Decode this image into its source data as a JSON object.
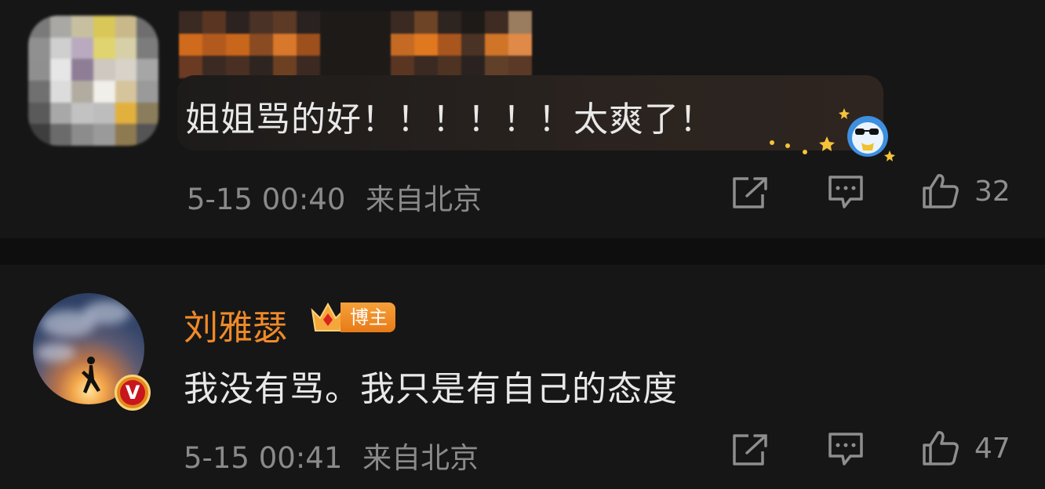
{
  "comments": [
    {
      "text": "姐姐骂的好！！！！！！太爽了！",
      "timestamp": "5-15 00:40",
      "location": "来自北京",
      "likes": "32",
      "author_blurred": true,
      "sticker": "blue-cartoon-with-sunglasses-icon"
    },
    {
      "author": "刘雅瑟",
      "badge": "博主",
      "verified_badge": "V",
      "text": "我没有骂。我只是有自己的态度",
      "timestamp": "5-15 00:41",
      "location": "来自北京",
      "likes": "47"
    }
  ],
  "icons": {
    "share": "share-icon",
    "comment": "comment-icon",
    "like": "thumbs-up-icon",
    "crown": "crown-icon"
  },
  "colors": {
    "background": "#161616",
    "author_name": "#f08a28",
    "muted_text": "#8a8a8a",
    "verified_badge": "#e28a1c"
  }
}
